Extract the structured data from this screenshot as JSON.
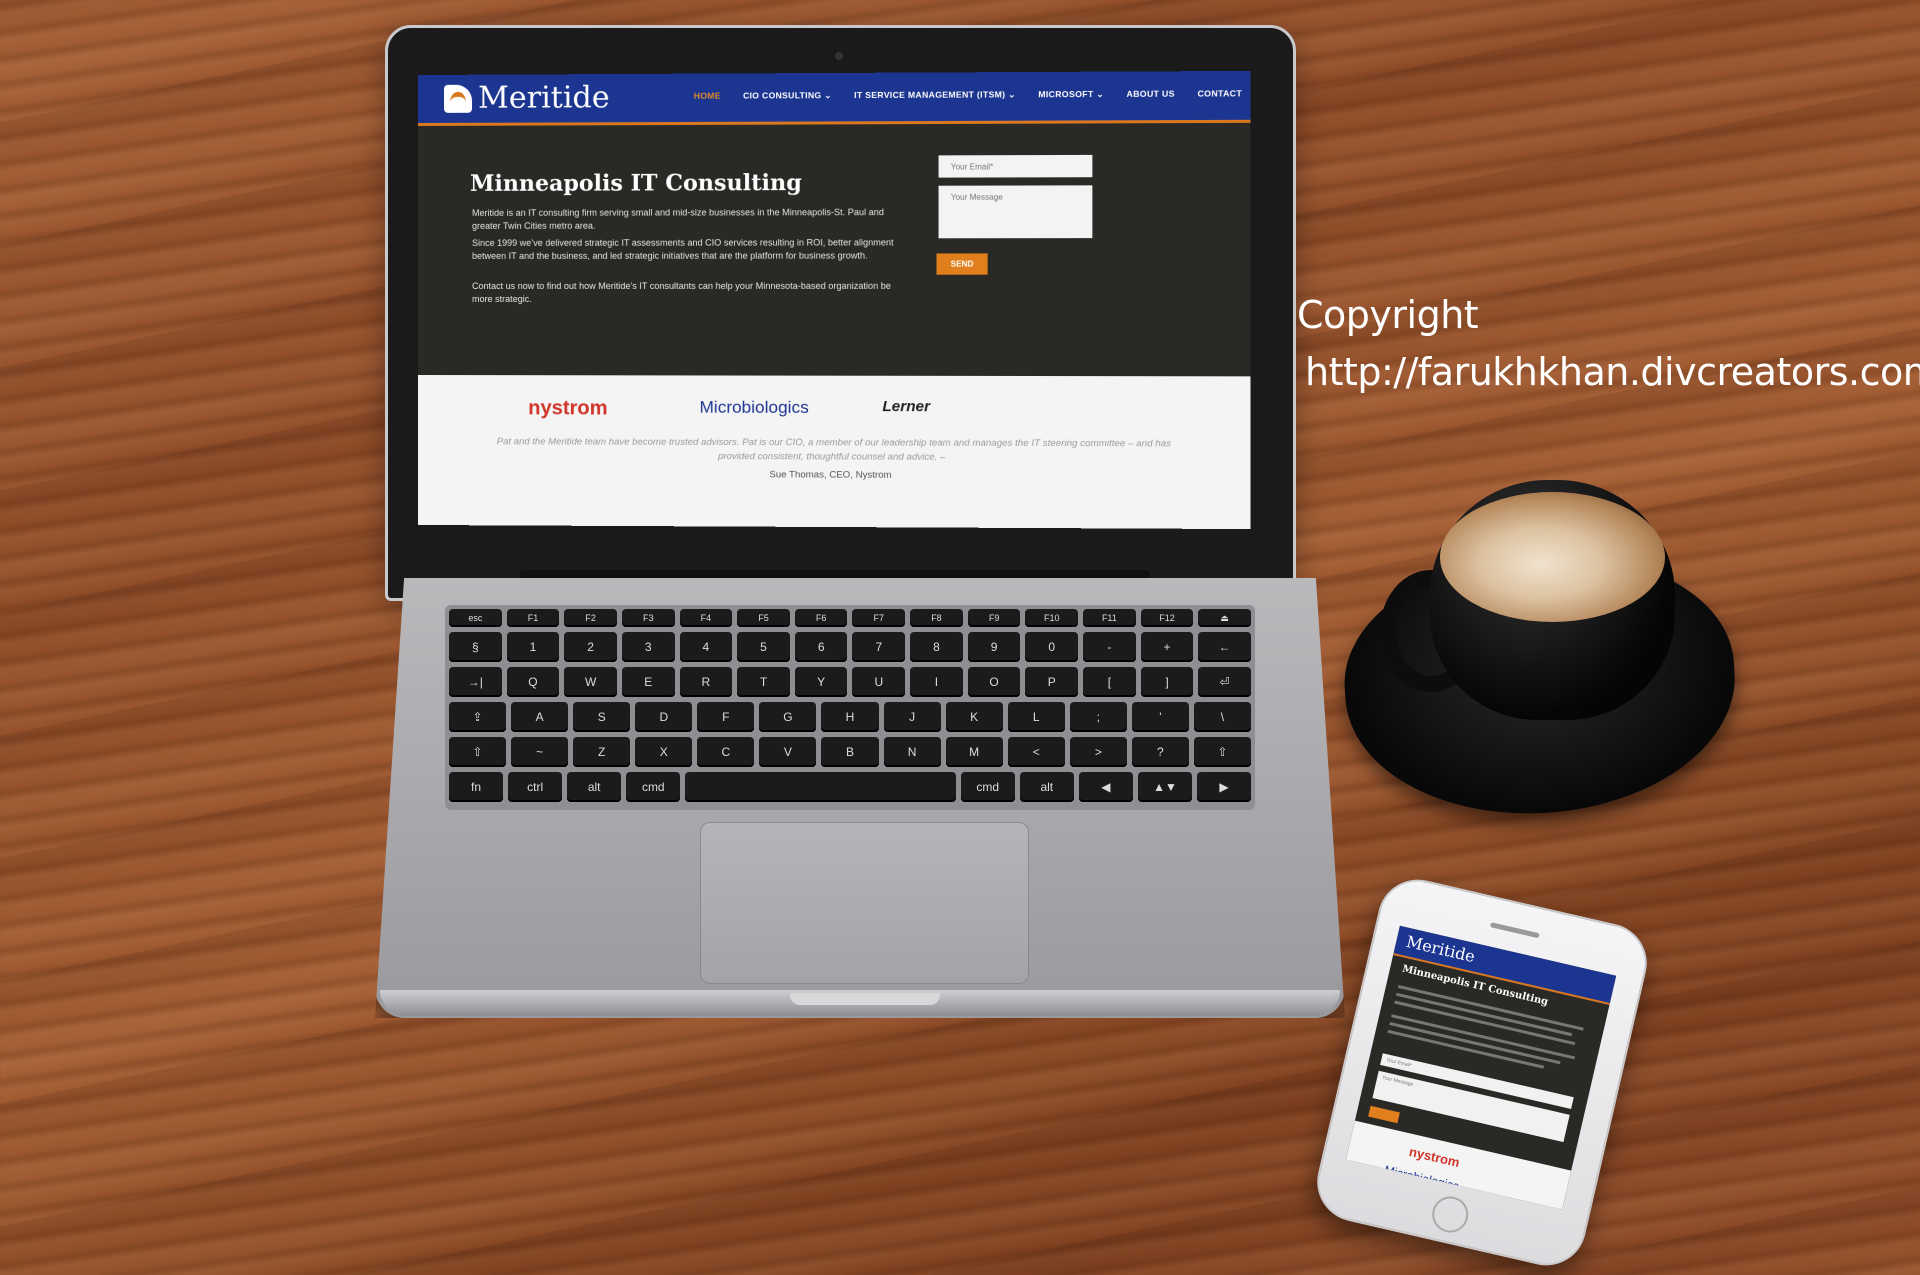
{
  "site": {
    "logo": "Meritide",
    "nav": [
      {
        "label": "HOME",
        "active": true
      },
      {
        "label": "CIO CONSULTING ⌄",
        "active": false
      },
      {
        "label": "IT SERVICE MANAGEMENT (ITSM) ⌄",
        "active": false
      },
      {
        "label": "MICROSOFT ⌄",
        "active": false
      },
      {
        "label": "ABOUT US",
        "active": false
      },
      {
        "label": "CONTACT",
        "active": false
      }
    ],
    "hero": {
      "title": "Minneapolis IT Consulting",
      "p1": "Meritide is an IT consulting firm serving small and mid-size businesses in the Minneapolis-St. Paul and greater Twin Cities metro area.",
      "p2": "Since 1999 we’ve delivered strategic IT assessments and CIO services resulting in ROI, better alignment between IT and the business, and led strategic initiatives that are the platform for business growth.",
      "p3": "Contact us now to find out how Meritide’s IT consultants can help your Minnesota-based organization be more strategic."
    },
    "form": {
      "email_placeholder": "Your Email*",
      "message_placeholder": "Your Message",
      "send_label": "SEND"
    },
    "clients": [
      "nystrom",
      "Microbiologics",
      "Lerner"
    ],
    "quote": "Pat and the Meritide team have become trusted advisors. Pat is our CIO, a member of our leadership team and manages the IT steering committee – and has provided consistent, thoughtful counsel and advice. –",
    "cite": "Sue Thomas, CEO, Nystrom"
  },
  "keyboard": {
    "fn": [
      "esc",
      "F1",
      "F2",
      "F3",
      "F4",
      "F5",
      "F6",
      "F7",
      "F8",
      "F9",
      "F10",
      "F11",
      "F12",
      "⏏"
    ],
    "row1": [
      "§",
      "1",
      "2",
      "3",
      "4",
      "5",
      "6",
      "7",
      "8",
      "9",
      "0",
      "-",
      "+",
      "←"
    ],
    "row2": [
      "→|",
      "Q",
      "W",
      "E",
      "R",
      "T",
      "Y",
      "U",
      "I",
      "O",
      "P",
      "[",
      "]",
      "⏎"
    ],
    "row3": [
      "⇪",
      "A",
      "S",
      "D",
      "F",
      "G",
      "H",
      "J",
      "K",
      "L",
      ";",
      "'",
      "\\"
    ],
    "row4": [
      "⇧",
      "~",
      "Z",
      "X",
      "C",
      "V",
      "B",
      "N",
      "M",
      "<",
      ">",
      "?",
      "⇧"
    ],
    "row5": [
      "fn",
      "ctrl",
      "alt",
      "cmd",
      "",
      "cmd",
      "alt",
      "◀",
      "▲▼",
      "▶"
    ]
  },
  "phone": {
    "logo": "Meritide",
    "title": "Minneapolis IT Consulting",
    "email_placeholder": "Your Email*",
    "message_placeholder": "Your Message",
    "clients": [
      "nystrom",
      "Microbiologics"
    ]
  },
  "watermark": {
    "line1": "Copyright",
    "line2": "http://farukhkhan.divcreators.com"
  },
  "colors": {
    "brand_blue": "#1c3591",
    "accent_orange": "#e07f1c"
  }
}
